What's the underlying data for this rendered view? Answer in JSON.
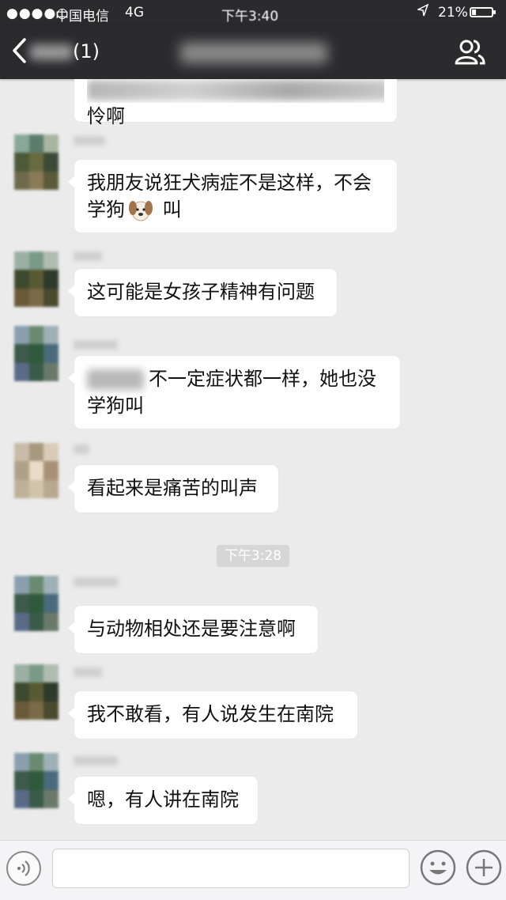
{
  "status_bar": {
    "signal": "●●●●○",
    "carrier": "中国电信",
    "network": "4G",
    "time": "下午3:40",
    "battery_percent": "21%",
    "battery_level": 0.21
  },
  "header": {
    "back_icon": "chevron-left-icon",
    "count": "(1)",
    "group_icon": "group-members-icon"
  },
  "messages": [
    {
      "text": "怜啊"
    },
    {
      "text_before": "我朋友说狂犬病症不是这样，不会学狗",
      "emoji": "dog-face-icon",
      "text_after": " 叫"
    },
    {
      "text": "这可能是女孩子精神有问题"
    },
    {
      "text": "不一定症状都一样，她也没学狗叫"
    },
    {
      "text": "看起来是痛苦的叫声"
    },
    {
      "text": "与动物相处还是要注意啊"
    },
    {
      "text": "我不敢看，有人说发生在南院"
    },
    {
      "text": "嗯，有人讲在南院"
    }
  ],
  "time_divider": "下午3:28",
  "input_bar": {
    "voice_icon": "voice-icon",
    "input_value": "",
    "emoji_icon": "emoji-icon",
    "plus_icon": "plus-icon"
  },
  "colors": {
    "header_bg": "#2b2b2d",
    "chat_bg": "#ebebeb",
    "bubble_bg": "#ffffff"
  }
}
